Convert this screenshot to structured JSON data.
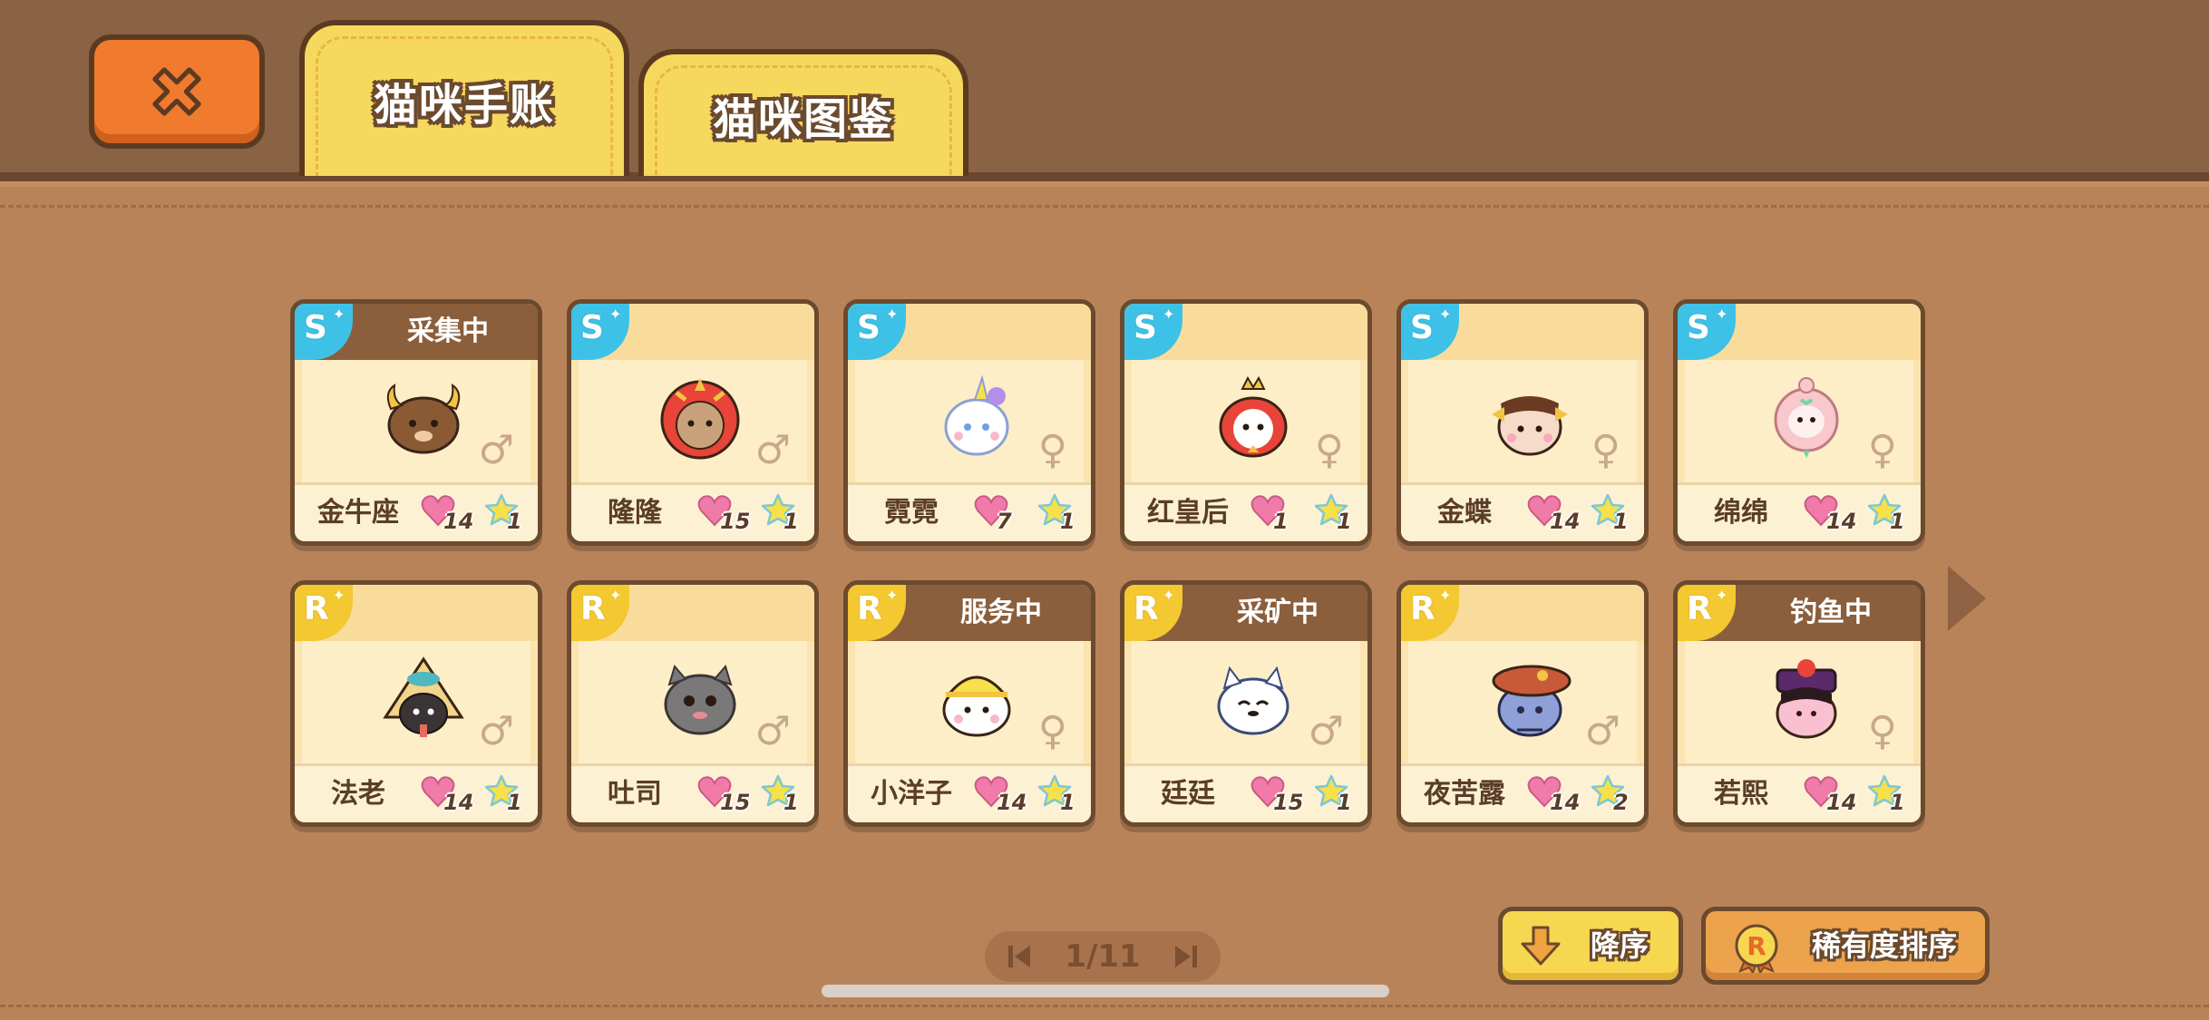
{
  "header": {
    "close_icon": "close-x-icon",
    "tabs": [
      {
        "label": "猫咪手账",
        "selected": true
      },
      {
        "label": "猫咪图鉴",
        "selected": false
      }
    ]
  },
  "cats": [
    {
      "name": "金牛座",
      "rarity": "S",
      "status": "采集中",
      "gender": "♂",
      "hearts": "14",
      "stars": "1",
      "portrait": "bull-cat-icon"
    },
    {
      "name": "隆隆",
      "rarity": "S",
      "status": "",
      "gender": "♂",
      "hearts": "15",
      "stars": "1",
      "portrait": "lion-dance-cat-icon"
    },
    {
      "name": "霓霓",
      "rarity": "S",
      "status": "",
      "gender": "♀",
      "hearts": "7",
      "stars": "1",
      "portrait": "unicorn-cat-icon"
    },
    {
      "name": "红皇后",
      "rarity": "S",
      "status": "",
      "gender": "♀",
      "hearts": "1",
      "stars": "1",
      "portrait": "red-queen-cat-icon"
    },
    {
      "name": "金蝶",
      "rarity": "S",
      "status": "",
      "gender": "♀",
      "hearts": "14",
      "stars": "1",
      "portrait": "butterfly-cat-icon"
    },
    {
      "name": "绵绵",
      "rarity": "S",
      "status": "",
      "gender": "♀",
      "hearts": "14",
      "stars": "1",
      "portrait": "sheep-cat-icon"
    },
    {
      "name": "法老",
      "rarity": "R",
      "status": "",
      "gender": "♂",
      "hearts": "14",
      "stars": "1",
      "portrait": "pharaoh-cat-icon"
    },
    {
      "name": "吐司",
      "rarity": "R",
      "status": "",
      "gender": "♂",
      "hearts": "15",
      "stars": "1",
      "portrait": "gray-cat-icon"
    },
    {
      "name": "小洋子",
      "rarity": "R",
      "status": "服务中",
      "gender": "♀",
      "hearts": "14",
      "stars": "1",
      "portrait": "hardhat-cat-icon"
    },
    {
      "name": "廷廷",
      "rarity": "R",
      "status": "采矿中",
      "gender": "♂",
      "hearts": "15",
      "stars": "1",
      "portrait": "white-cat-icon"
    },
    {
      "name": "夜苦露",
      "rarity": "R",
      "status": "",
      "gender": "♂",
      "hearts": "14",
      "stars": "2",
      "portrait": "beret-cat-icon"
    },
    {
      "name": "若熙",
      "rarity": "R",
      "status": "钓鱼中",
      "gender": "♀",
      "hearts": "14",
      "stars": "1",
      "portrait": "qing-lady-cat-icon"
    }
  ],
  "pager": {
    "text": "1/11"
  },
  "sort": {
    "order_label": "降序",
    "rarity_label": "稀有度排序",
    "rarity_icon_letter": "R"
  },
  "colors": {
    "s_badge": "#3ec1e6",
    "r_badge": "#f3c830",
    "accent_orange": "#f07a2e",
    "tab_yellow": "#f6d85e",
    "heart": "#f07aa8",
    "star": "#f7e04a"
  }
}
